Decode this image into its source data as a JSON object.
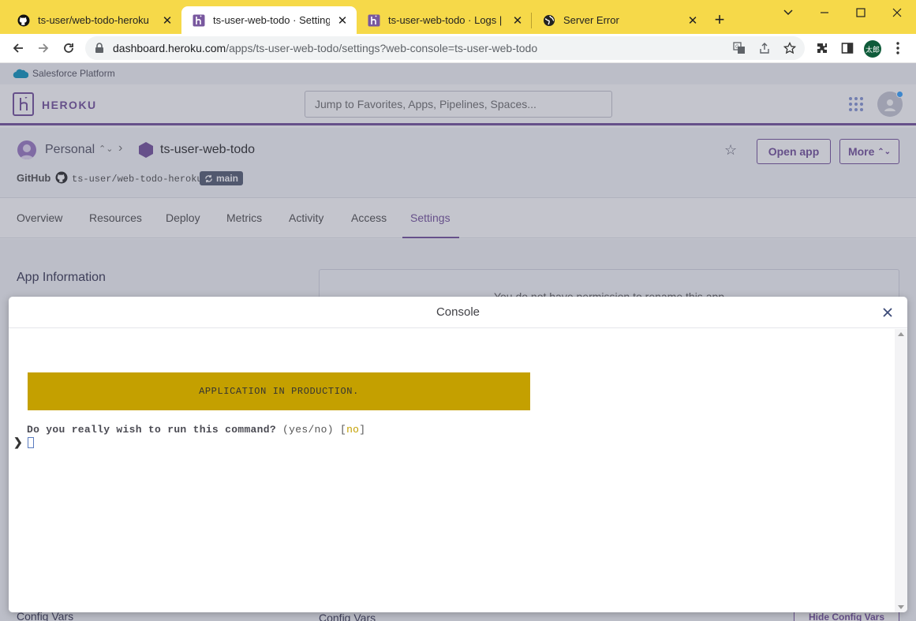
{
  "browser": {
    "tabs": [
      {
        "title": "ts-user/web-todo-heroku",
        "icon": "github-icon"
      },
      {
        "title": "ts-user-web-todo · Settings | Heroku",
        "icon": "heroku-icon"
      },
      {
        "title": "ts-user-web-todo · Logs | Heroku",
        "icon": "heroku-icon"
      },
      {
        "title": "Server Error",
        "icon": "globe-icon"
      }
    ],
    "url_host": "dashboard.heroku.com",
    "url_path": "/apps/ts-user-web-todo/settings?web-console=ts-user-web-todo",
    "profile_label": "太郎"
  },
  "salesforce": {
    "label": "Salesforce Platform"
  },
  "heroku": {
    "brand": "HEROKU",
    "search_placeholder": "Jump to Favorites, Apps, Pipelines, Spaces..."
  },
  "app": {
    "account": "Personal",
    "name": "ts-user-web-todo",
    "open_app": "Open app",
    "more": "More",
    "more_chevron": "⌃⌄",
    "github_label": "GitHub",
    "repo": "ts-user/web-todo-heroku",
    "branch": "main"
  },
  "nav": [
    "Overview",
    "Resources",
    "Deploy",
    "Metrics",
    "Activity",
    "Access",
    "Settings"
  ],
  "content": {
    "section_title": "App Information",
    "rename_notice": "You do not have permission to rename this app",
    "config_vars_left": "Config Vars",
    "config_vars_right": "Config Vars",
    "hide_config_vars": "Hide Config Vars"
  },
  "console": {
    "title": "Console",
    "banner": "APPLICATION IN PRODUCTION.",
    "question": "Do you really wish to run this command?",
    "options": " (yes/no) ",
    "default_open": "[",
    "default_value": "no",
    "default_close": "]",
    "prompt_symbol": "❯"
  },
  "colors": {
    "tabbar": "#f6d949",
    "heroku_purple": "#79589f",
    "banner": "#c4a000"
  }
}
